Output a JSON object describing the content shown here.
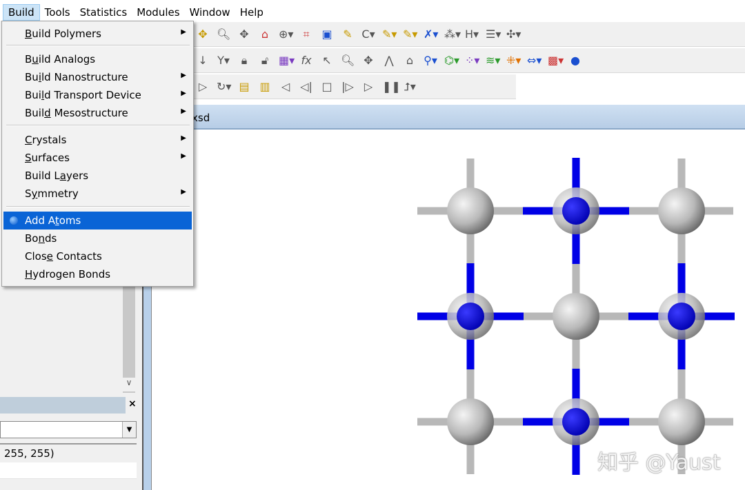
{
  "menubar": {
    "items": [
      "Build",
      "Tools",
      "Statistics",
      "Modules",
      "Window",
      "Help"
    ],
    "active": "Build"
  },
  "build_menu": {
    "items": [
      {
        "label": "Build Polymers",
        "ul": "B",
        "submenu": true
      },
      {
        "label": "Build Analogs",
        "ul": "u",
        "submenu": false
      },
      {
        "label": "Build Nanostructure",
        "ul": "i",
        "submenu": true
      },
      {
        "label": "Build Transport Device",
        "ul": "l",
        "submenu": true
      },
      {
        "label": "Build Mesostructure",
        "ul": "d",
        "submenu": true
      },
      {
        "label": "Crystals",
        "ul": "C",
        "submenu": true
      },
      {
        "label": "Surfaces",
        "ul": "S",
        "submenu": true
      },
      {
        "label": "Build Layers",
        "ul": "a",
        "submenu": false
      },
      {
        "label": "Symmetry",
        "ul": "y",
        "submenu": true
      },
      {
        "label": "Add Atoms",
        "ul": "t",
        "submenu": false,
        "highlighted": true,
        "icon": "atom-icon"
      },
      {
        "label": "Bonds",
        "ul": "n",
        "submenu": false
      },
      {
        "label": "Close Contacts",
        "ul": "e",
        "submenu": false
      },
      {
        "label": "Hydrogen Bonds",
        "ul": "H",
        "submenu": false
      }
    ]
  },
  "document": {
    "tab_title": "xsd"
  },
  "left_panel": {
    "property_value": "255, 255)",
    "close": "×"
  },
  "watermark": "知乎 @Yaust",
  "colors": {
    "highlight": "#0a64d6",
    "atom_grey": "#c0c0c0",
    "atom_blue": "#0000e6",
    "tab": "#c4d8ee"
  }
}
